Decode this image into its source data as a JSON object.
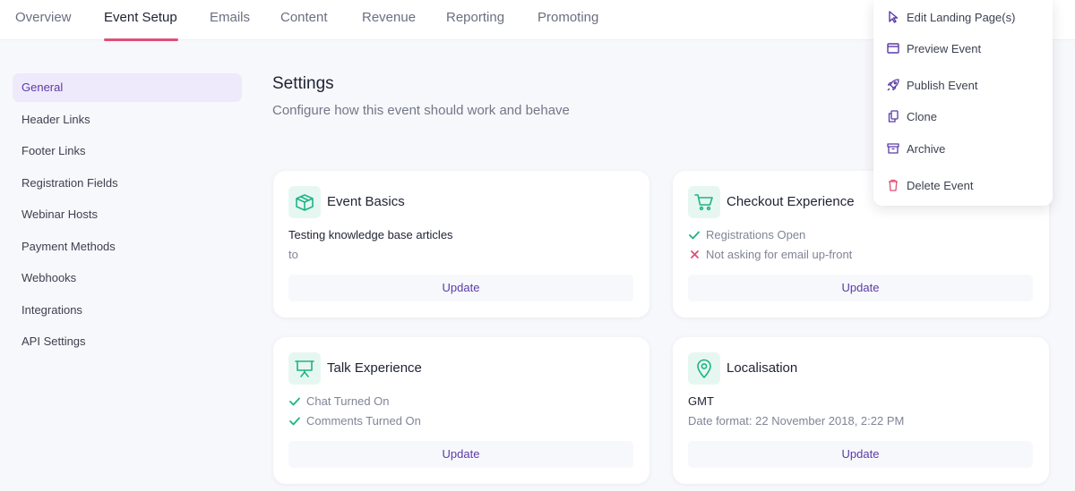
{
  "colors": {
    "accent": "#5b3aa8",
    "tab_underline": "#e04f76",
    "icon_green": "#1eb386",
    "danger": "#e04f76"
  },
  "tabs": [
    {
      "label": "Overview",
      "active": false
    },
    {
      "label": "Event Setup",
      "active": true
    },
    {
      "label": "Emails",
      "active": false
    },
    {
      "label": "Content",
      "active": false
    },
    {
      "label": "Revenue",
      "active": false
    },
    {
      "label": "Reporting",
      "active": false
    },
    {
      "label": "Promoting",
      "active": false
    }
  ],
  "sidebar": {
    "items": [
      {
        "label": "General",
        "active": true
      },
      {
        "label": "Header Links"
      },
      {
        "label": "Footer Links"
      },
      {
        "label": "Registration Fields"
      },
      {
        "label": "Webinar Hosts"
      },
      {
        "label": "Payment Methods"
      },
      {
        "label": "Webhooks"
      },
      {
        "label": "Integrations"
      },
      {
        "label": "API Settings"
      }
    ]
  },
  "header": {
    "title": "Settings",
    "subtitle": "Configure how this event should work and behave"
  },
  "cards": {
    "event_basics": {
      "icon": "box-icon",
      "title": "Event Basics",
      "line1": "Testing knowledge base articles",
      "line2": "to",
      "button": "Update"
    },
    "checkout": {
      "icon": "cart-icon",
      "title": "Checkout Experience",
      "line1": "Registrations Open",
      "line1_status": "check",
      "line2": "Not asking for email up-front",
      "line2_status": "cross",
      "button": "Update"
    },
    "talk": {
      "icon": "presentation-icon",
      "title": "Talk Experience",
      "line1": "Chat Turned On",
      "line1_status": "check",
      "line2": "Comments Turned On",
      "line2_status": "check",
      "button": "Update"
    },
    "localisation": {
      "icon": "location-pin-icon",
      "title": "Localisation",
      "line1": "GMT",
      "line2": "Date format: 22 November 2018, 2:22 PM",
      "button": "Update"
    }
  },
  "menu": {
    "items": [
      {
        "label": "Edit Landing Page(s)",
        "icon": "cursor-icon"
      },
      {
        "label": "Preview Event",
        "icon": "browser-window-icon"
      },
      {
        "label": "Publish Event",
        "icon": "rocket-icon"
      },
      {
        "label": "Clone",
        "icon": "copy-icon"
      },
      {
        "label": "Archive",
        "icon": "archive-box-icon"
      },
      {
        "label": "Delete Event",
        "icon": "trash-icon"
      }
    ]
  }
}
